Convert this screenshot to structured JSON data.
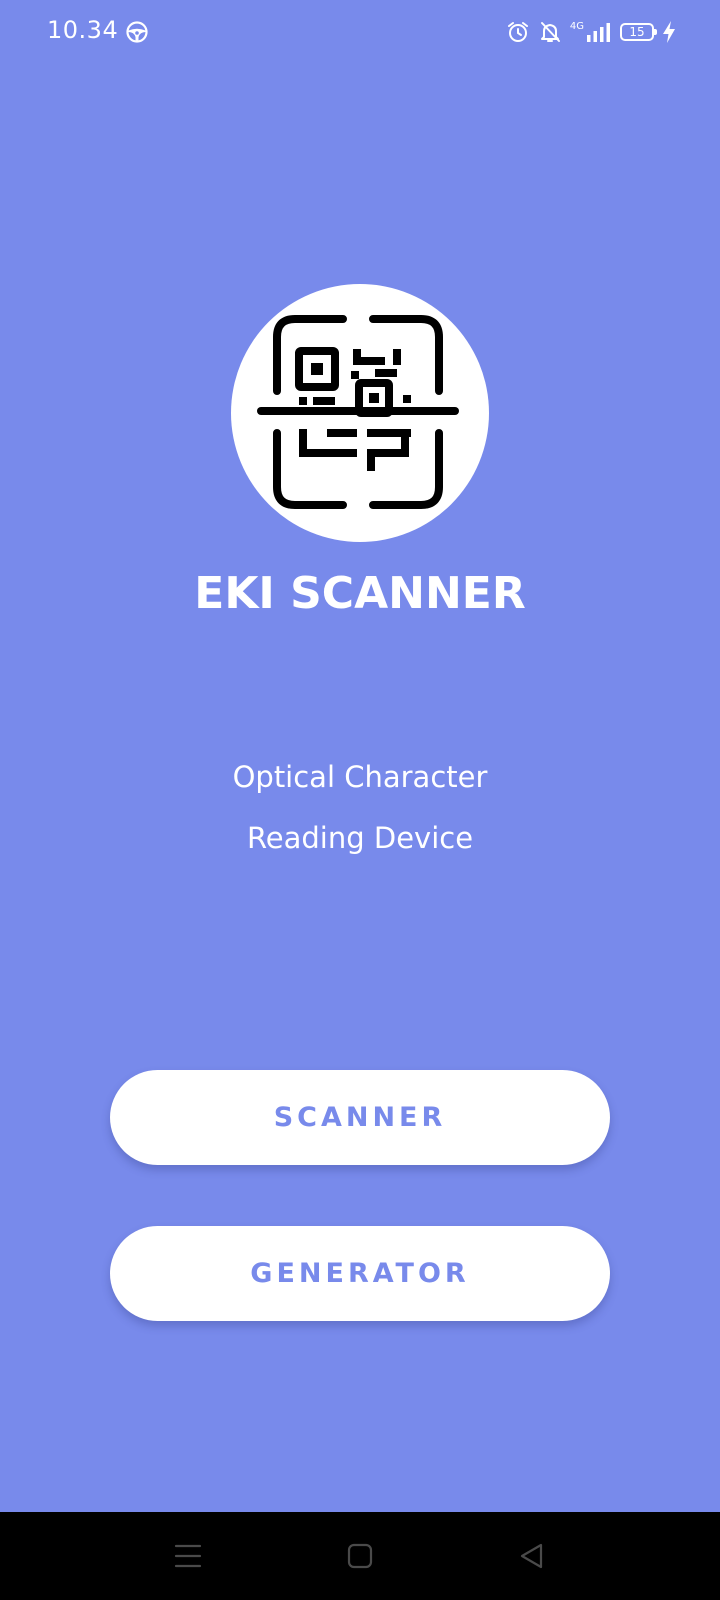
{
  "status_bar": {
    "time": "10.34",
    "network": "4G",
    "battery_level": "15",
    "icons": [
      "steering-wheel-icon",
      "alarm-icon",
      "bell-muted-icon",
      "signal-icon",
      "battery-icon",
      "charging-icon"
    ]
  },
  "app": {
    "logo_icon": "qr-scan-icon",
    "title": "EKI SCANNER",
    "subtitle_line1": "Optical Character",
    "subtitle_line2": "Reading Device"
  },
  "buttons": {
    "scanner_label": "SCANNER",
    "generator_label": "GENERATOR"
  },
  "nav_bar": {
    "icons": [
      "menu-icon",
      "home-icon",
      "back-icon"
    ]
  },
  "colors": {
    "background": "#788aeb",
    "button_bg": "#ffffff",
    "button_text": "#788aeb",
    "nav_bar": "#000000"
  }
}
